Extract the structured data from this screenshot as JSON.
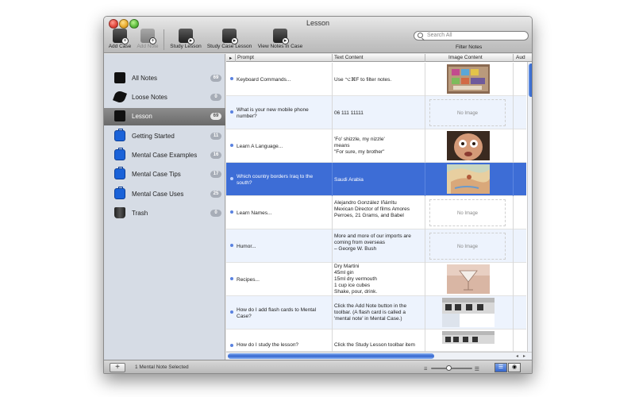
{
  "window": {
    "title": "Lesson"
  },
  "toolbar": {
    "add_case": "Add Case",
    "add_note": "Add Note",
    "study_lesson": "Study Lesson",
    "study_case_lesson": "Study Case Lesson",
    "view_notes_in_case": "View Notes in Case",
    "search_placeholder": "Search All",
    "filter_notes": "Filter Notes"
  },
  "sidebar": {
    "items": [
      {
        "label": "All Notes",
        "count": "69",
        "icon": "all-notes-icon"
      },
      {
        "label": "Loose Notes",
        "count": "0",
        "icon": "feather-icon"
      },
      {
        "label": "Lesson",
        "count": "69",
        "icon": "lesson-icon"
      },
      {
        "label": "Getting Started",
        "count": "11",
        "icon": "briefcase-icon"
      },
      {
        "label": "Mental Case Examples",
        "count": "16",
        "icon": "briefcase-icon"
      },
      {
        "label": "Mental Case Tips",
        "count": "17",
        "icon": "briefcase-icon"
      },
      {
        "label": "Mental Case Uses",
        "count": "25",
        "icon": "briefcase-icon"
      },
      {
        "label": "Trash",
        "count": "0",
        "icon": "trash-icon"
      }
    ]
  },
  "table": {
    "columns": {
      "prompt": "Prompt",
      "text": "Text Content",
      "image": "Image Content",
      "audio": "Aud"
    },
    "no_image": "No Image",
    "rows": [
      {
        "prompt": "Keyboard Commands...",
        "text": "Use ⌥⌘F to filter notes.",
        "image": "keyboard"
      },
      {
        "prompt": "What is your new mobile phone number?",
        "text": "06 111 11111",
        "image": "none"
      },
      {
        "prompt": "Learn A Language...",
        "text": "'Fo' shizzle, my nizzle'\nmeans\n\"For sure, my brother\"",
        "image": "face"
      },
      {
        "prompt": "Which country borders Iraq to the south?",
        "text": "Saudi Arabia",
        "image": "map"
      },
      {
        "prompt": "Learn Names...",
        "text": "Alejandro González Iñárritu\nMexican Director of films Amores Perroes, 21 Grams, and Babel",
        "image": "none"
      },
      {
        "prompt": "Humor...",
        "text": "More and more of our imports are coming from overseas\n– George W. Bush",
        "image": "none"
      },
      {
        "prompt": "Recipes...",
        "text": "Dry Martini\n45ml gin\n15ml dry vermouth\n1 cup ice cubes\nShake, pour, drink.",
        "image": "martini"
      },
      {
        "prompt": "How do I add flash cards to Mental Case?",
        "text": "Click the Add Note button in the toolbar. (A flash card is called a 'mental note' in Mental Case.)",
        "image": "screenshot"
      },
      {
        "prompt": "How do I study the lesson?",
        "text": "Click the Study Lesson toolbar item",
        "image": "screenshot2"
      }
    ]
  },
  "status": {
    "text": "1 Mental Note Selected"
  },
  "colors": {
    "selection": "#3d6dd6",
    "sidebar_bg": "#d6dce5",
    "case_blue": "#1a62d8"
  }
}
